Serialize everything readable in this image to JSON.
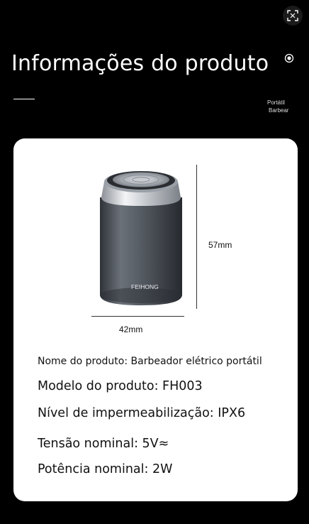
{
  "header": {
    "title": "Informações do produto",
    "tag_line1": "Portátil",
    "tag_line2": "Barbear"
  },
  "icons": {
    "scan": "scan-icon",
    "target": "target-icon"
  },
  "product": {
    "brand": "FEIHONG",
    "height_label": "57mm",
    "width_label": "42mm"
  },
  "specs": {
    "name": "Nome do produto: Barbeador elétrico portátil",
    "model": "Modelo do produto: FH003",
    "waterproof": "Nível de impermeabilização: IPX6",
    "voltage": "Tensão nominal: 5V≈",
    "power": "Potência nominal: 2W"
  },
  "colors": {
    "background": "#000000",
    "card": "#ffffff",
    "body_metal": "#4a4f56"
  }
}
